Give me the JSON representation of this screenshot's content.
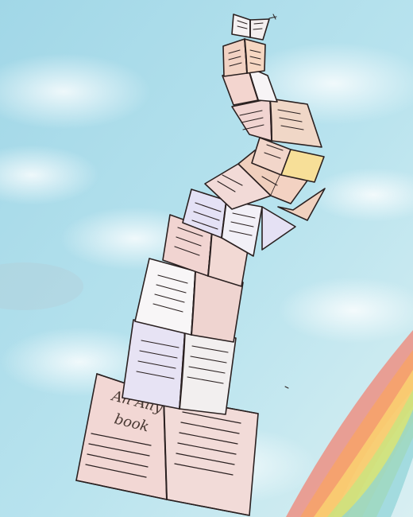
{
  "illustration": {
    "cover_text_line1": "An Ally",
    "cover_text_line2": "book"
  },
  "colors": {
    "sky": "#a9dde9",
    "cloud": "#eef7f8",
    "ink": "#2a2020",
    "book_pink": "#f0d6cf",
    "book_peach": "#f2cfb8",
    "book_white": "#f7f4f6",
    "book_lavender": "#e7e3f4",
    "book_yellow": "#f6df98",
    "rainbow": [
      "#f57b6a",
      "#fb9f5f",
      "#fdd36c",
      "#c7e67a",
      "#8ad2d5"
    ]
  },
  "icons": {
    "stack": "stacked-books-icon",
    "rainbow": "rainbow-icon",
    "clouds": "cloud-icon"
  }
}
